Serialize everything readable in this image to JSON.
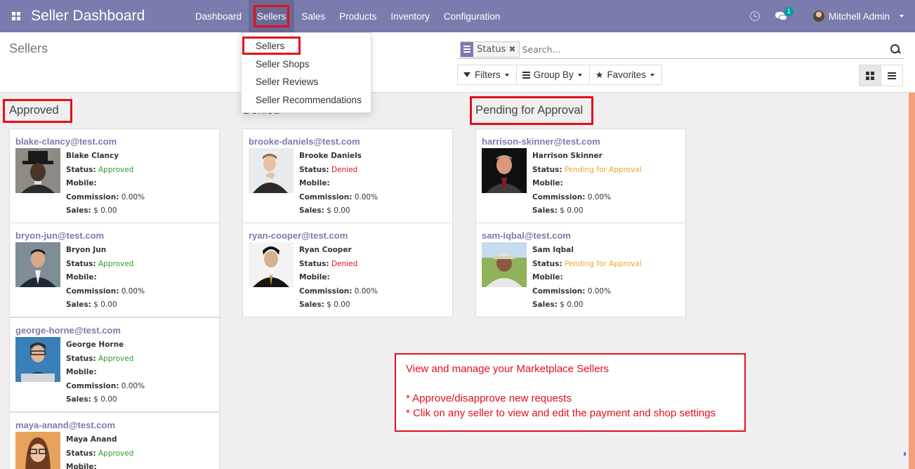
{
  "navbar": {
    "brand": "Seller Dashboard",
    "menu": [
      "Dashboard",
      "Sellers",
      "Sales",
      "Products",
      "Inventory",
      "Configuration"
    ],
    "active_menu": "Sellers",
    "chat_badge": "1",
    "user": "Mitchell Admin"
  },
  "dropdown": {
    "items": [
      "Sellers",
      "Seller Shops",
      "Seller Reviews",
      "Seller Recommendations"
    ]
  },
  "control": {
    "title": "Sellers",
    "facet": "Status",
    "search_placeholder": "Search...",
    "filters": "Filters",
    "group_by": "Group By",
    "favorites": "Favorites"
  },
  "labels": {
    "status": "Status:",
    "mobile": "Mobile:",
    "commission": "Commission:",
    "sales": "Sales:"
  },
  "columns": [
    {
      "title": "Approved",
      "cards": [
        {
          "email": "blake-clancy@test.com",
          "name": "Blake Clancy",
          "status": "Approved",
          "commission": "0.00%",
          "sales": "$ 0.00"
        },
        {
          "email": "bryon-jun@test.com",
          "name": "Bryon Jun",
          "status": "Approved",
          "commission": "0.00%",
          "sales": "$ 0.00"
        },
        {
          "email": "george-horne@test.com",
          "name": "George Horne",
          "status": "Approved",
          "commission": "0.00%",
          "sales": "$ 0.00"
        },
        {
          "email": "maya-anand@test.com",
          "name": "Maya Anand",
          "status": "Approved",
          "commission": "",
          "sales": ""
        }
      ]
    },
    {
      "title": "Denied",
      "cards": [
        {
          "email": "brooke-daniels@test.com",
          "name": "Brooke Daniels",
          "status": "Denied",
          "commission": "0.00%",
          "sales": "$ 0.00"
        },
        {
          "email": "ryan-cooper@test.com",
          "name": "Ryan Cooper",
          "status": "Denied",
          "commission": "0.00%",
          "sales": "$ 0.00"
        }
      ]
    },
    {
      "title": "Pending for Approval",
      "cards": [
        {
          "email": "harrison-skinner@test.com",
          "name": "Harrison Skinner",
          "status": "Pending for Approval",
          "commission": "0.00%",
          "sales": "$ 0.00"
        },
        {
          "email": "sam-iqbal@test.com",
          "name": "Sam Iqbal",
          "status": "Pending for Approval",
          "commission": "0.00%",
          "sales": "$ 0.00"
        }
      ]
    }
  ],
  "note": {
    "line1": "View and manage your Marketplace Sellers",
    "line2": "* Approve/disapprove new requests",
    "line3": "* Clik on any seller to view and edit the payment and shop settings"
  },
  "colors": {
    "navbar": "#7c7bad",
    "highlight": "#e1101c",
    "approved": "#2f9a2f",
    "denied": "#e1101c",
    "pending": "#f0a22e"
  }
}
